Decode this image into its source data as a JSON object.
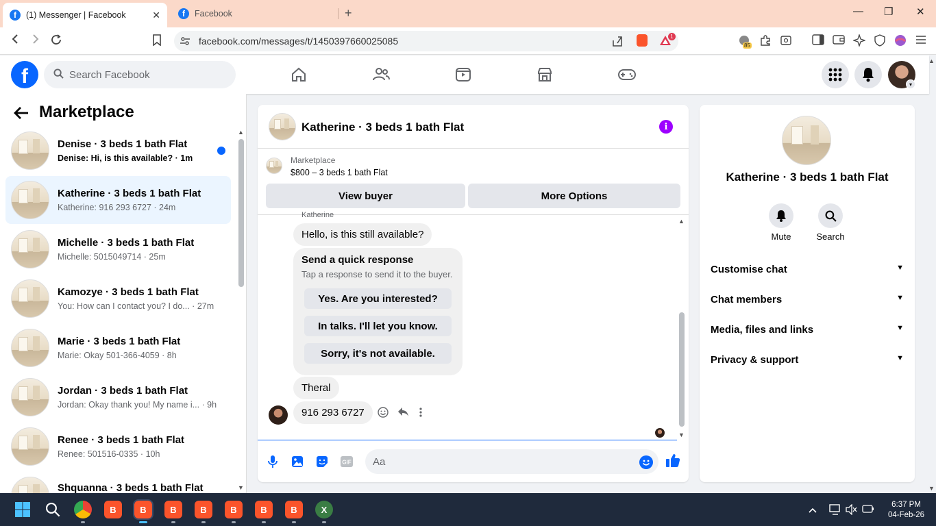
{
  "browser": {
    "tabs": [
      {
        "title": "(1) Messenger | Facebook",
        "active": true
      },
      {
        "title": "Facebook",
        "active": false
      }
    ],
    "url": "facebook.com/messages/t/1450397660025085",
    "ext_badge_count": "85",
    "brave_alert_count": "1"
  },
  "fb": {
    "search_placeholder": "Search Facebook"
  },
  "left": {
    "title": "Marketplace",
    "conversations": [
      {
        "name": "Denise · 3 beds 1 bath Flat",
        "snippet": "Denise: Hi, is this available? · 1m",
        "unread": true
      },
      {
        "name": "Katherine · 3 beds 1 bath Flat",
        "snippet": "Katherine: 916 293 6727 · 24m",
        "selected": true
      },
      {
        "name": "Michelle · 3 beds 1 bath Flat",
        "snippet": "Michelle: 5015049714 · 25m"
      },
      {
        "name": "Kamozye · 3 beds 1 bath Flat",
        "snippet": "You: How can I contact you? I do... · 27m"
      },
      {
        "name": "Marie · 3 beds 1 bath Flat",
        "snippet": "Marie: Okay 501-366-4059 · 8h"
      },
      {
        "name": "Jordan · 3 beds 1 bath Flat",
        "snippet": "Jordan: Okay thank you! My name i... · 9h"
      },
      {
        "name": "Renee · 3 beds 1 bath Flat",
        "snippet": "Renee: 501516-0335 · 10h"
      },
      {
        "name": "Shquanna · 3 beds 1 bath Flat",
        "snippet": ""
      }
    ]
  },
  "chat": {
    "title": "Katherine · 3 beds 1 bath Flat",
    "marketplace_label": "Marketplace",
    "listing": "$800 – 3 beds 1 bath Flat",
    "view_buyer": "View buyer",
    "more_options": "More Options",
    "sender": "Katherine",
    "msg1": "Hello, is this still available?",
    "quick": {
      "title": "Send a quick response",
      "subtitle": "Tap a response to send it to the buyer.",
      "options": [
        "Yes. Are you interested?",
        "In talks. I'll let you know.",
        "Sorry, it's not available."
      ]
    },
    "msg2": "Theral",
    "msg3": "916 293 6727",
    "compose_placeholder": "Aa"
  },
  "right": {
    "name": "Katherine · 3 beds 1 bath Flat",
    "mute": "Mute",
    "search": "Search",
    "sections": [
      "Customise chat",
      "Chat members",
      "Media, files and links",
      "Privacy & support"
    ]
  },
  "taskbar": {
    "time": "6:37 PM",
    "date": "04-Feb-26"
  },
  "colors": {
    "fb_blue": "#0866ff",
    "selected_bg": "#ebf5ff",
    "info_purple": "#9d00ff",
    "tab_bar": "#fbd9c9"
  }
}
